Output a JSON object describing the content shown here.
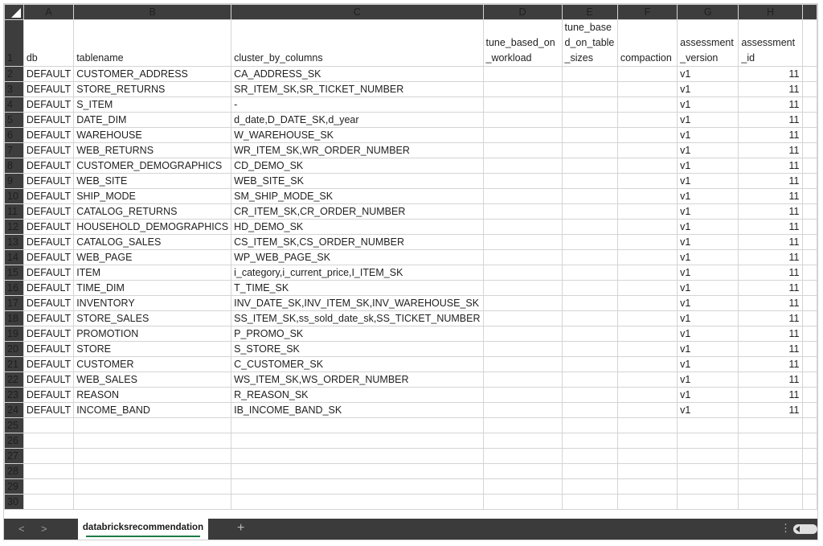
{
  "columns": [
    "A",
    "B",
    "C",
    "D",
    "E",
    "F",
    "G",
    "H"
  ],
  "header_row": {
    "num": "1",
    "cells": [
      "db",
      "tablename",
      "cluster_by_columns",
      "tune_based_on_workload",
      "tune_based_on_table_sizes",
      "compaction",
      "assessment_version",
      "assessment_id"
    ]
  },
  "rows": [
    {
      "num": "2",
      "cells": [
        "DEFAULT",
        "CUSTOMER_ADDRESS",
        "CA_ADDRESS_SK",
        "",
        "",
        "",
        "v1",
        "11"
      ]
    },
    {
      "num": "3",
      "cells": [
        "DEFAULT",
        "STORE_RETURNS",
        "SR_ITEM_SK,SR_TICKET_NUMBER",
        "",
        "",
        "",
        "v1",
        "11"
      ]
    },
    {
      "num": "4",
      "cells": [
        "DEFAULT",
        "S_ITEM",
        "-",
        "",
        "",
        "",
        "v1",
        "11"
      ]
    },
    {
      "num": "5",
      "cells": [
        "DEFAULT",
        "DATE_DIM",
        "d_date,D_DATE_SK,d_year",
        "",
        "",
        "",
        "v1",
        "11"
      ]
    },
    {
      "num": "6",
      "cells": [
        "DEFAULT",
        "WAREHOUSE",
        "W_WAREHOUSE_SK",
        "",
        "",
        "",
        "v1",
        "11"
      ]
    },
    {
      "num": "7",
      "cells": [
        "DEFAULT",
        "WEB_RETURNS",
        "WR_ITEM_SK,WR_ORDER_NUMBER",
        "",
        "",
        "",
        "v1",
        "11"
      ]
    },
    {
      "num": "8",
      "cells": [
        "DEFAULT",
        "CUSTOMER_DEMOGRAPHICS",
        "CD_DEMO_SK",
        "",
        "",
        "",
        "v1",
        "11"
      ]
    },
    {
      "num": "9",
      "cells": [
        "DEFAULT",
        "WEB_SITE",
        "WEB_SITE_SK",
        "",
        "",
        "",
        "v1",
        "11"
      ]
    },
    {
      "num": "10",
      "cells": [
        "DEFAULT",
        "SHIP_MODE",
        "SM_SHIP_MODE_SK",
        "",
        "",
        "",
        "v1",
        "11"
      ]
    },
    {
      "num": "11",
      "cells": [
        "DEFAULT",
        "CATALOG_RETURNS",
        "CR_ITEM_SK,CR_ORDER_NUMBER",
        "",
        "",
        "",
        "v1",
        "11"
      ]
    },
    {
      "num": "12",
      "cells": [
        "DEFAULT",
        "HOUSEHOLD_DEMOGRAPHICS",
        "HD_DEMO_SK",
        "",
        "",
        "",
        "v1",
        "11"
      ]
    },
    {
      "num": "13",
      "cells": [
        "DEFAULT",
        "CATALOG_SALES",
        "CS_ITEM_SK,CS_ORDER_NUMBER",
        "",
        "",
        "",
        "v1",
        "11"
      ]
    },
    {
      "num": "14",
      "cells": [
        "DEFAULT",
        "WEB_PAGE",
        "WP_WEB_PAGE_SK",
        "",
        "",
        "",
        "v1",
        "11"
      ]
    },
    {
      "num": "15",
      "cells": [
        "DEFAULT",
        "ITEM",
        "i_category,i_current_price,I_ITEM_SK",
        "",
        "",
        "",
        "v1",
        "11"
      ]
    },
    {
      "num": "16",
      "cells": [
        "DEFAULT",
        "TIME_DIM",
        "T_TIME_SK",
        "",
        "",
        "",
        "v1",
        "11"
      ]
    },
    {
      "num": "17",
      "cells": [
        "DEFAULT",
        "INVENTORY",
        "INV_DATE_SK,INV_ITEM_SK,INV_WAREHOUSE_SK",
        "",
        "",
        "",
        "v1",
        "11"
      ]
    },
    {
      "num": "18",
      "cells": [
        "DEFAULT",
        "STORE_SALES",
        "SS_ITEM_SK,ss_sold_date_sk,SS_TICKET_NUMBER",
        "",
        "",
        "",
        "v1",
        "11"
      ]
    },
    {
      "num": "19",
      "cells": [
        "DEFAULT",
        "PROMOTION",
        "P_PROMO_SK",
        "",
        "",
        "",
        "v1",
        "11"
      ]
    },
    {
      "num": "20",
      "cells": [
        "DEFAULT",
        "STORE",
        "S_STORE_SK",
        "",
        "",
        "",
        "v1",
        "11"
      ]
    },
    {
      "num": "21",
      "cells": [
        "DEFAULT",
        "CUSTOMER",
        "C_CUSTOMER_SK",
        "",
        "",
        "",
        "v1",
        "11"
      ]
    },
    {
      "num": "22",
      "cells": [
        "DEFAULT",
        "WEB_SALES",
        "WS_ITEM_SK,WS_ORDER_NUMBER",
        "",
        "",
        "",
        "v1",
        "11"
      ]
    },
    {
      "num": "23",
      "cells": [
        "DEFAULT",
        "REASON",
        "R_REASON_SK",
        "",
        "",
        "",
        "v1",
        "11"
      ]
    },
    {
      "num": "24",
      "cells": [
        "DEFAULT",
        "INCOME_BAND",
        "IB_INCOME_BAND_SK",
        "",
        "",
        "",
        "v1",
        "11"
      ]
    }
  ],
  "empty_rows": [
    "25",
    "26",
    "27",
    "28",
    "29",
    "30"
  ],
  "sheet_tab": {
    "label": "databricksrecommendation"
  },
  "tabbar": {
    "prev": "<",
    "next": ">",
    "add": "+",
    "menu": "⋮"
  }
}
